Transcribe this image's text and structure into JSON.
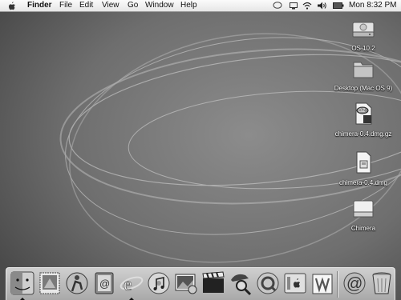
{
  "menubar": {
    "app": "Finder",
    "menus": [
      "File",
      "Edit",
      "View",
      "Go",
      "Window",
      "Help"
    ],
    "clock": "Mon 8:32 PM"
  },
  "desktop": {
    "icons": [
      {
        "label": "OS 10.2",
        "icon": "hard-drive-icon"
      },
      {
        "label": "Desktop (Mac OS 9)",
        "icon": "folder-icon"
      },
      {
        "label": "chimera-0.4.dmg.gz",
        "icon": "gzip-archive-icon"
      },
      {
        "label": "chimera-0.4.dmg",
        "icon": "disk-image-icon"
      },
      {
        "label": "Chimera",
        "icon": "mounted-volume-icon"
      }
    ]
  },
  "dock": {
    "items": [
      {
        "icon": "finder-icon",
        "running": true
      },
      {
        "icon": "mail-stamp-icon",
        "running": false
      },
      {
        "icon": "ichat-icon",
        "running": false
      },
      {
        "icon": "address-book-icon",
        "running": false
      },
      {
        "icon": "internet-explorer-icon",
        "running": true
      },
      {
        "icon": "itunes-icon",
        "running": false
      },
      {
        "icon": "iphoto-icon",
        "running": false
      },
      {
        "icon": "imovie-icon",
        "running": false
      },
      {
        "icon": "sherlock-icon",
        "running": false
      },
      {
        "icon": "quicktime-icon",
        "running": false
      },
      {
        "icon": "system-preferences-icon",
        "running": false
      },
      {
        "icon": "text-edit-icon",
        "running": false
      },
      {
        "icon": "mail-icon",
        "running": false
      },
      {
        "icon": "trash-icon",
        "running": false
      }
    ]
  }
}
